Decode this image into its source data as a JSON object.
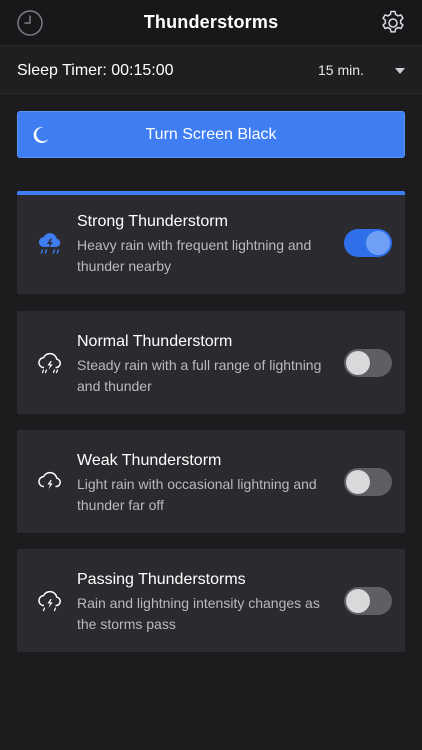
{
  "nav": {
    "title": "Thunderstorms",
    "left_icon": "clock-icon",
    "right_icon": "gear-icon"
  },
  "timer": {
    "label": "Sleep Timer: 00:15:00",
    "selected": "15 min."
  },
  "black_button": {
    "label": "Turn Screen Black",
    "icon": "moon-icon"
  },
  "colors": {
    "accent": "#3f7ef2",
    "background": "#1c1c1f",
    "card": "#2b2b2f"
  },
  "sounds": [
    {
      "title": "Strong Thunderstorm",
      "desc": "Heavy rain with frequent lightning and thunder nearby",
      "enabled": true,
      "icon": "storm-cloud-icon"
    },
    {
      "title": "Normal Thunderstorm",
      "desc": "Steady rain with a full range of lightning and thunder",
      "enabled": false,
      "icon": "storm-cloud-icon"
    },
    {
      "title": "Weak Thunderstorm",
      "desc": "Light rain with occasional lightning and thunder far off",
      "enabled": false,
      "icon": "storm-cloud-icon"
    },
    {
      "title": "Passing Thunderstorms",
      "desc": "Rain and lightning intensity changes as the storms pass",
      "enabled": false,
      "icon": "storm-cloud-icon"
    }
  ]
}
